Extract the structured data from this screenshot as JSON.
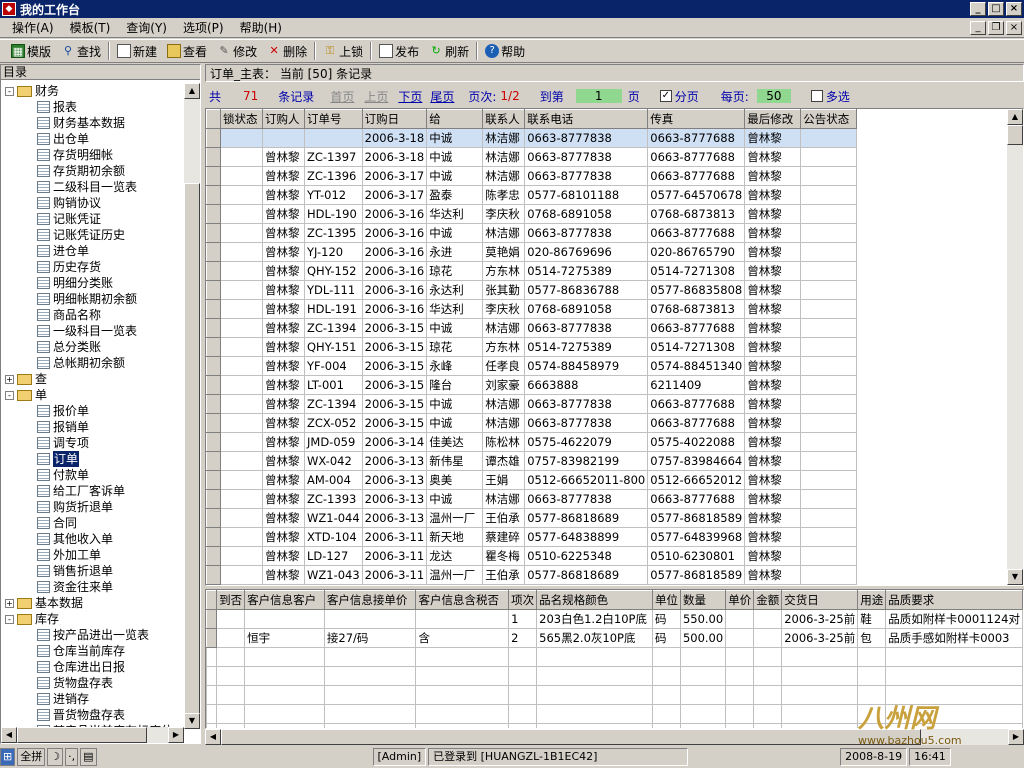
{
  "window": {
    "title": "我的工作台"
  },
  "menu": [
    "操作(A)",
    "模板(T)",
    "查询(Y)",
    "选项(P)",
    "帮助(H)"
  ],
  "toolbar": {
    "template": "模版",
    "find": "查找",
    "new": "新建",
    "view": "查看",
    "edit": "修改",
    "delete": "删除",
    "lock": "上锁",
    "publish": "发布",
    "refresh": "刷新",
    "help": "帮助"
  },
  "tree": {
    "header": "目录",
    "nodes": [
      {
        "type": "folder",
        "toggle": "-",
        "label": "财务"
      },
      {
        "type": "leaf",
        "label": "报表"
      },
      {
        "type": "leaf",
        "label": "财务基本数据"
      },
      {
        "type": "leaf",
        "label": "出仓单"
      },
      {
        "type": "leaf",
        "label": "存货明细帐"
      },
      {
        "type": "leaf",
        "label": "存货期初余额"
      },
      {
        "type": "leaf",
        "label": "二级科目一览表"
      },
      {
        "type": "leaf",
        "label": "购销协议"
      },
      {
        "type": "leaf",
        "label": "记账凭证"
      },
      {
        "type": "leaf",
        "label": "记账凭证历史"
      },
      {
        "type": "leaf",
        "label": "进仓单"
      },
      {
        "type": "leaf",
        "label": "历史存货"
      },
      {
        "type": "leaf",
        "label": "明细分类账"
      },
      {
        "type": "leaf",
        "label": "明细帐期初余额"
      },
      {
        "type": "leaf",
        "label": "商品名称"
      },
      {
        "type": "leaf",
        "label": "一级科目一览表"
      },
      {
        "type": "leaf",
        "label": "总分类账"
      },
      {
        "type": "leaf",
        "label": "总帐期初余额"
      },
      {
        "type": "folder",
        "toggle": "+",
        "label": "查"
      },
      {
        "type": "folder",
        "toggle": "-",
        "label": "单"
      },
      {
        "type": "leaf",
        "label": "报价单"
      },
      {
        "type": "leaf",
        "label": "报销单"
      },
      {
        "type": "leaf",
        "label": "调专项"
      },
      {
        "type": "leaf",
        "label": "订单",
        "selected": true
      },
      {
        "type": "leaf",
        "label": "付款单"
      },
      {
        "type": "leaf",
        "label": "给工厂客诉单"
      },
      {
        "type": "leaf",
        "label": "购货折退单"
      },
      {
        "type": "leaf",
        "label": "合同"
      },
      {
        "type": "leaf",
        "label": "其他收入单"
      },
      {
        "type": "leaf",
        "label": "外加工单"
      },
      {
        "type": "leaf",
        "label": "销售折退单"
      },
      {
        "type": "leaf",
        "label": "资金往来单"
      },
      {
        "type": "folder",
        "toggle": "+",
        "label": "基本数据"
      },
      {
        "type": "folder",
        "toggle": "-",
        "label": "库存"
      },
      {
        "type": "leaf",
        "label": "按产品进出一览表"
      },
      {
        "type": "leaf",
        "label": "仓库当前库存"
      },
      {
        "type": "leaf",
        "label": "仓库进出日报"
      },
      {
        "type": "leaf",
        "label": "货物盘存表"
      },
      {
        "type": "leaf",
        "label": "进销存"
      },
      {
        "type": "leaf",
        "label": "晋货物盘存表"
      },
      {
        "type": "leaf",
        "label": "某产品当前库存标库位"
      }
    ]
  },
  "panel_title": "订单_主表：  当前  [50]  条记录",
  "nav": {
    "total_prefix": "共",
    "total": "71",
    "records": "条记录",
    "first": "首页",
    "prev": "上页",
    "next": "下页",
    "last": "尾页",
    "page_label": "页次:",
    "page": "1/2",
    "goto_label": "到第",
    "goto_value": "1",
    "goto_suffix": "页",
    "paging_label": "分页",
    "per_page_label": "每页:",
    "per_page": "50",
    "multi_label": "多选"
  },
  "main_table": {
    "columns": [
      "锁状态",
      "订购人",
      "订单号",
      "订购日",
      "给",
      "联系人",
      "联系电话",
      "传真",
      "最后修改",
      "公告状态"
    ],
    "rows": [
      [
        "",
        "",
        "",
        "2006-3-18",
        "中诚",
        "林洁娜",
        "0663-8777838",
        "0663-8777688",
        "曾林黎",
        ""
      ],
      [
        "",
        "曾林黎",
        "ZC-1397",
        "2006-3-18",
        "中诚",
        "林洁娜",
        "0663-8777838",
        "0663-8777688",
        "曾林黎",
        ""
      ],
      [
        "",
        "曾林黎",
        "ZC-1396",
        "2006-3-17",
        "中诚",
        "林洁娜",
        "0663-8777838",
        "0663-8777688",
        "曾林黎",
        ""
      ],
      [
        "",
        "曾林黎",
        "YT-012",
        "2006-3-17",
        "盈泰",
        "陈孝忠",
        "0577-68101188",
        "0577-64570678",
        "曾林黎",
        ""
      ],
      [
        "",
        "曾林黎",
        "HDL-190",
        "2006-3-16",
        "华达利",
        "李庆秋",
        "0768-6891058",
        "0768-6873813",
        "曾林黎",
        ""
      ],
      [
        "",
        "曾林黎",
        "ZC-1395",
        "2006-3-16",
        "中诚",
        "林洁娜",
        "0663-8777838",
        "0663-8777688",
        "曾林黎",
        ""
      ],
      [
        "",
        "曾林黎",
        "YJ-120",
        "2006-3-16",
        "永进",
        "莫艳娟",
        "020-86769696",
        "020-86765790",
        "曾林黎",
        ""
      ],
      [
        "",
        "曾林黎",
        "QHY-152",
        "2006-3-16",
        "琼花",
        "方东林",
        "0514-7275389",
        "0514-7271308",
        "曾林黎",
        ""
      ],
      [
        "",
        "曾林黎",
        "YDL-111",
        "2006-3-16",
        "永达利",
        "张其勤",
        "0577-86836788",
        "0577-86835808",
        "曾林黎",
        ""
      ],
      [
        "",
        "曾林黎",
        "HDL-191",
        "2006-3-16",
        "华达利",
        "李庆秋",
        "0768-6891058",
        "0768-6873813",
        "曾林黎",
        ""
      ],
      [
        "",
        "曾林黎",
        "ZC-1394",
        "2006-3-15",
        "中诚",
        "林洁娜",
        "0663-8777838",
        "0663-8777688",
        "曾林黎",
        ""
      ],
      [
        "",
        "曾林黎",
        "QHY-151",
        "2006-3-15",
        "琼花",
        "方东林",
        "0514-7275389",
        "0514-7271308",
        "曾林黎",
        ""
      ],
      [
        "",
        "曾林黎",
        "YF-004",
        "2006-3-15",
        "永峰",
        "任孝良",
        "0574-88458979",
        "0574-88451340",
        "曾林黎",
        ""
      ],
      [
        "",
        "曾林黎",
        "LT-001",
        "2006-3-15",
        "隆台",
        "刘家豪",
        "6663888",
        "6211409",
        "曾林黎",
        ""
      ],
      [
        "",
        "曾林黎",
        "ZC-1394",
        "2006-3-15",
        "中诚",
        "林洁娜",
        "0663-8777838",
        "0663-8777688",
        "曾林黎",
        ""
      ],
      [
        "",
        "曾林黎",
        "ZCX-052",
        "2006-3-15",
        "中诚",
        "林洁娜",
        "0663-8777838",
        "0663-8777688",
        "曾林黎",
        ""
      ],
      [
        "",
        "曾林黎",
        "JMD-059",
        "2006-3-14",
        "佳美达",
        "陈松林",
        "0575-4622079",
        "0575-4022088",
        "曾林黎",
        ""
      ],
      [
        "",
        "曾林黎",
        "WX-042",
        "2006-3-13",
        "新伟星",
        "谭杰雄",
        "0757-83982199",
        "0757-83984664",
        "曾林黎",
        ""
      ],
      [
        "",
        "曾林黎",
        "AM-004",
        "2006-3-13",
        "奥美",
        "王娟",
        "0512-66652011-800",
        "0512-66652012",
        "曾林黎",
        ""
      ],
      [
        "",
        "曾林黎",
        "ZC-1393",
        "2006-3-13",
        "中诚",
        "林洁娜",
        "0663-8777838",
        "0663-8777688",
        "曾林黎",
        ""
      ],
      [
        "",
        "曾林黎",
        "WZ1-044",
        "2006-3-13",
        "温州一厂",
        "王伯承",
        "0577-86818689",
        "0577-86818589",
        "曾林黎",
        ""
      ],
      [
        "",
        "曾林黎",
        "XTD-104",
        "2006-3-11",
        "新天地",
        "蔡建碎",
        "0577-64838899",
        "0577-64839968",
        "曾林黎",
        ""
      ],
      [
        "",
        "曾林黎",
        "LD-127",
        "2006-3-11",
        "龙达",
        "瞿冬梅",
        "0510-6225348",
        "0510-6230801",
        "曾林黎",
        ""
      ],
      [
        "",
        "曾林黎",
        "WZ1-043",
        "2006-3-11",
        "温州一厂",
        "王伯承",
        "0577-86818689",
        "0577-86818589",
        "曾林黎",
        ""
      ]
    ]
  },
  "detail_table": {
    "columns": [
      "到否",
      "客户信息客户",
      "客户信息接单价",
      "客户信息含税否",
      "项次",
      "品名规格颜色",
      "单位",
      "数量",
      "单价",
      "金额",
      "交货日",
      "用途",
      "品质要求"
    ],
    "rows": [
      [
        "",
        "",
        "",
        "",
        "1",
        "203白色1.2白10P底",
        "码",
        "550.00",
        "",
        "",
        "2006-3-25前",
        "鞋",
        "品质如附样卡0001124对"
      ],
      [
        "",
        "恒宇",
        "接27/码",
        "含",
        "2",
        "565黑2.0灰10P底",
        "码",
        "500.00",
        "",
        "",
        "2006-3-25前",
        "包",
        "品质手感如附样卡0003"
      ]
    ]
  },
  "status": {
    "ime_mode": "全拼",
    "admin": "[Admin]",
    "login": "已登录到 [HUANGZL-1B1EC42]",
    "date": "2008-8-19",
    "time": "16:41"
  },
  "watermark": {
    "brand": "八州网",
    "url": "www.bazhou5.com"
  }
}
